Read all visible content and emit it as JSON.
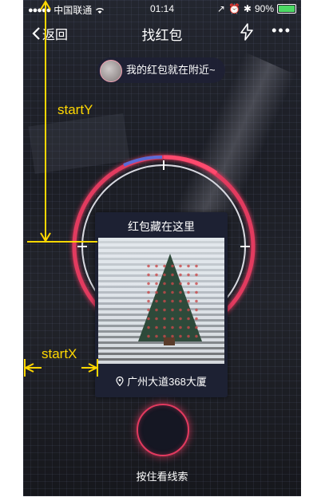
{
  "status_bar": {
    "carrier": "中国联通",
    "time": "01:14",
    "battery": "90%",
    "battery_level": 0.9
  },
  "navbar": {
    "back_label": "返回",
    "title": "找红包",
    "icons": [
      "chevron-left-icon",
      "flash-icon",
      "more-icon"
    ]
  },
  "hint_pill": {
    "text": "我的红包就在附近~"
  },
  "card": {
    "title": "红包藏在这里",
    "location": "广州大道368大厦"
  },
  "scan_button_label": "按住看线索",
  "annotations": {
    "start_y": "startY",
    "start_x": "startX"
  },
  "colors": {
    "accent": "#e23a5f",
    "annotation": "#ffd700",
    "card_bg": "#1d2133",
    "scan_arc": "#5b6bd6"
  }
}
